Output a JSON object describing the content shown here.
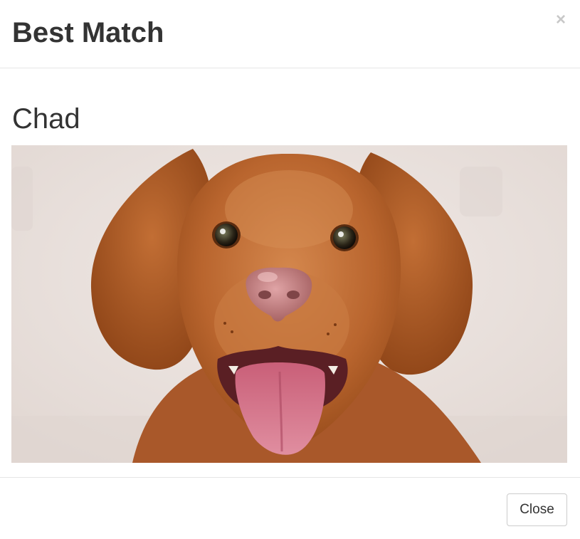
{
  "modal": {
    "title": "Best Match",
    "close_icon_glyph": "×",
    "close_label": "Close"
  },
  "match": {
    "name": "Chad",
    "photo_subject": "dog-photo"
  },
  "colors": {
    "fur": "#b8612a",
    "fur_light": "#cf7f45",
    "fur_dark": "#8d4418",
    "background": "#ebe3df",
    "nose": "#c9838a",
    "tongue": "#d9798c",
    "border": "#e5e5e5",
    "button_border": "#cccccc"
  }
}
